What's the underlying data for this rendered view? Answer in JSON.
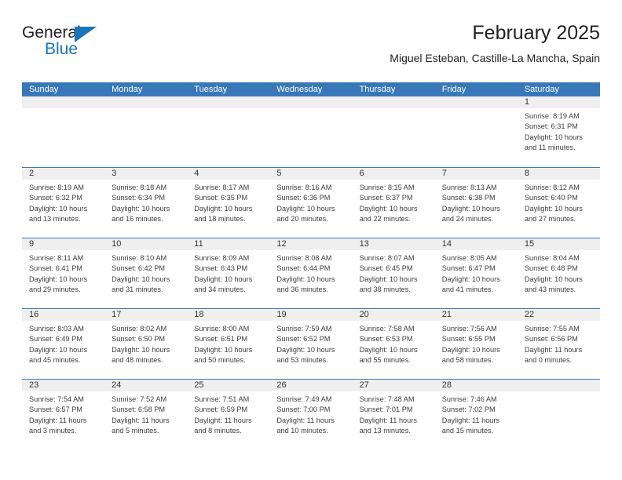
{
  "logo": {
    "word_general": "General",
    "word_blue": "Blue",
    "triangle_color": "#1b75bb"
  },
  "header": {
    "title": "February 2025",
    "subtitle": "Miguel Esteban, Castille-La Mancha, Spain"
  },
  "colors": {
    "header_blue": "#3878b9",
    "band_gray": "#efefef",
    "text_dark": "#231f20",
    "logo_blue": "#1b75bb"
  },
  "calendar": {
    "weekdays": [
      "Sunday",
      "Monday",
      "Tuesday",
      "Wednesday",
      "Thursday",
      "Friday",
      "Saturday"
    ],
    "weeks": [
      [
        {
          "day": "",
          "lines": []
        },
        {
          "day": "",
          "lines": []
        },
        {
          "day": "",
          "lines": []
        },
        {
          "day": "",
          "lines": []
        },
        {
          "day": "",
          "lines": []
        },
        {
          "day": "",
          "lines": []
        },
        {
          "day": "1",
          "lines": [
            "Sunrise: 8:19 AM",
            "Sunset: 6:31 PM",
            "Daylight: 10 hours",
            "and 11 minutes."
          ]
        }
      ],
      [
        {
          "day": "2",
          "lines": [
            "Sunrise: 8:19 AM",
            "Sunset: 6:32 PM",
            "Daylight: 10 hours",
            "and 13 minutes."
          ]
        },
        {
          "day": "3",
          "lines": [
            "Sunrise: 8:18 AM",
            "Sunset: 6:34 PM",
            "Daylight: 10 hours",
            "and 16 minutes."
          ]
        },
        {
          "day": "4",
          "lines": [
            "Sunrise: 8:17 AM",
            "Sunset: 6:35 PM",
            "Daylight: 10 hours",
            "and 18 minutes."
          ]
        },
        {
          "day": "5",
          "lines": [
            "Sunrise: 8:16 AM",
            "Sunset: 6:36 PM",
            "Daylight: 10 hours",
            "and 20 minutes."
          ]
        },
        {
          "day": "6",
          "lines": [
            "Sunrise: 8:15 AM",
            "Sunset: 6:37 PM",
            "Daylight: 10 hours",
            "and 22 minutes."
          ]
        },
        {
          "day": "7",
          "lines": [
            "Sunrise: 8:13 AM",
            "Sunset: 6:38 PM",
            "Daylight: 10 hours",
            "and 24 minutes."
          ]
        },
        {
          "day": "8",
          "lines": [
            "Sunrise: 8:12 AM",
            "Sunset: 6:40 PM",
            "Daylight: 10 hours",
            "and 27 minutes."
          ]
        }
      ],
      [
        {
          "day": "9",
          "lines": [
            "Sunrise: 8:11 AM",
            "Sunset: 6:41 PM",
            "Daylight: 10 hours",
            "and 29 minutes."
          ]
        },
        {
          "day": "10",
          "lines": [
            "Sunrise: 8:10 AM",
            "Sunset: 6:42 PM",
            "Daylight: 10 hours",
            "and 31 minutes."
          ]
        },
        {
          "day": "11",
          "lines": [
            "Sunrise: 8:09 AM",
            "Sunset: 6:43 PM",
            "Daylight: 10 hours",
            "and 34 minutes."
          ]
        },
        {
          "day": "12",
          "lines": [
            "Sunrise: 8:08 AM",
            "Sunset: 6:44 PM",
            "Daylight: 10 hours",
            "and 36 minutes."
          ]
        },
        {
          "day": "13",
          "lines": [
            "Sunrise: 8:07 AM",
            "Sunset: 6:45 PM",
            "Daylight: 10 hours",
            "and 38 minutes."
          ]
        },
        {
          "day": "14",
          "lines": [
            "Sunrise: 8:05 AM",
            "Sunset: 6:47 PM",
            "Daylight: 10 hours",
            "and 41 minutes."
          ]
        },
        {
          "day": "15",
          "lines": [
            "Sunrise: 8:04 AM",
            "Sunset: 6:48 PM",
            "Daylight: 10 hours",
            "and 43 minutes."
          ]
        }
      ],
      [
        {
          "day": "16",
          "lines": [
            "Sunrise: 8:03 AM",
            "Sunset: 6:49 PM",
            "Daylight: 10 hours",
            "and 45 minutes."
          ]
        },
        {
          "day": "17",
          "lines": [
            "Sunrise: 8:02 AM",
            "Sunset: 6:50 PM",
            "Daylight: 10 hours",
            "and 48 minutes."
          ]
        },
        {
          "day": "18",
          "lines": [
            "Sunrise: 8:00 AM",
            "Sunset: 6:51 PM",
            "Daylight: 10 hours",
            "and 50 minutes."
          ]
        },
        {
          "day": "19",
          "lines": [
            "Sunrise: 7:59 AM",
            "Sunset: 6:52 PM",
            "Daylight: 10 hours",
            "and 53 minutes."
          ]
        },
        {
          "day": "20",
          "lines": [
            "Sunrise: 7:58 AM",
            "Sunset: 6:53 PM",
            "Daylight: 10 hours",
            "and 55 minutes."
          ]
        },
        {
          "day": "21",
          "lines": [
            "Sunrise: 7:56 AM",
            "Sunset: 6:55 PM",
            "Daylight: 10 hours",
            "and 58 minutes."
          ]
        },
        {
          "day": "22",
          "lines": [
            "Sunrise: 7:55 AM",
            "Sunset: 6:56 PM",
            "Daylight: 11 hours",
            "and 0 minutes."
          ]
        }
      ],
      [
        {
          "day": "23",
          "lines": [
            "Sunrise: 7:54 AM",
            "Sunset: 6:57 PM",
            "Daylight: 11 hours",
            "and 3 minutes."
          ]
        },
        {
          "day": "24",
          "lines": [
            "Sunrise: 7:52 AM",
            "Sunset: 6:58 PM",
            "Daylight: 11 hours",
            "and 5 minutes."
          ]
        },
        {
          "day": "25",
          "lines": [
            "Sunrise: 7:51 AM",
            "Sunset: 6:59 PM",
            "Daylight: 11 hours",
            "and 8 minutes."
          ]
        },
        {
          "day": "26",
          "lines": [
            "Sunrise: 7:49 AM",
            "Sunset: 7:00 PM",
            "Daylight: 11 hours",
            "and 10 minutes."
          ]
        },
        {
          "day": "27",
          "lines": [
            "Sunrise: 7:48 AM",
            "Sunset: 7:01 PM",
            "Daylight: 11 hours",
            "and 13 minutes."
          ]
        },
        {
          "day": "28",
          "lines": [
            "Sunrise: 7:46 AM",
            "Sunset: 7:02 PM",
            "Daylight: 11 hours",
            "and 15 minutes."
          ]
        },
        {
          "day": "",
          "lines": []
        }
      ]
    ]
  }
}
